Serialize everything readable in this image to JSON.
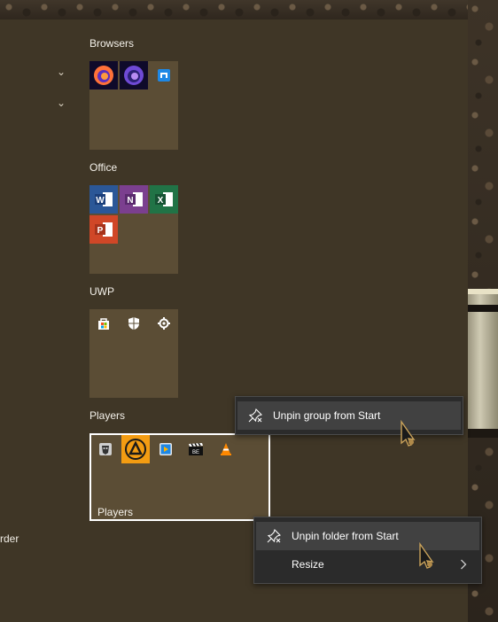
{
  "groups": [
    {
      "title": "Browsers"
    },
    {
      "title": "Office"
    },
    {
      "title": "UWP"
    },
    {
      "title": "Players"
    }
  ],
  "folder": {
    "label": "Players"
  },
  "left_clipped_text": "rder",
  "context_menu_group": {
    "items": [
      {
        "label": "Unpin group from Start",
        "icon": "unpin-icon"
      }
    ]
  },
  "context_menu_folder": {
    "items": [
      {
        "label": "Unpin folder from Start",
        "icon": "unpin-icon"
      },
      {
        "label": "Resize",
        "icon": "chevron-right-icon"
      }
    ]
  },
  "colors": {
    "panel_bg": "#3f3626",
    "group_bg": "#5b4d35",
    "menu_bg": "#2b2b2b",
    "menu_highlight": "#414141",
    "word_blue": "#2b5797",
    "onenote_purple": "#7b3f8f",
    "excel_green": "#217346",
    "powerpoint_red": "#d04727",
    "aimp_orange": "#f39c12"
  }
}
